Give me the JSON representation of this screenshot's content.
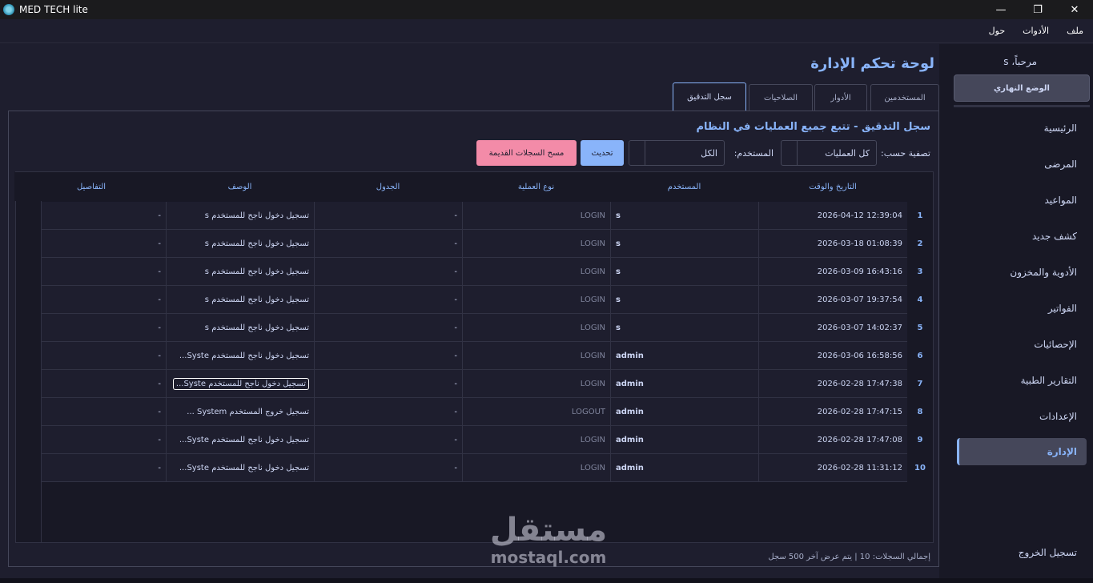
{
  "window": {
    "title": "MED TECH lite",
    "minimize": "—",
    "maximize": "❐",
    "close": "✕"
  },
  "menu": [
    "ملف",
    "الأدوات",
    "حول"
  ],
  "sidebar": {
    "welcome": "مرحباً، s",
    "theme_button": "الوضع النهاري",
    "items": [
      "الرئيسية",
      "المرضى",
      "المواعيد",
      "كشف جديد",
      "الأدوية والمخزون",
      "الفواتير",
      "الإحصائيات",
      "التقارير الطبية",
      "الإعدادات",
      "الإدارة"
    ],
    "active": "الإدارة",
    "logout": "تسجيل الخروج"
  },
  "main": {
    "title": "لوحة تحكم الإدارة",
    "tabs": [
      "المستخدمين",
      "الأدوار",
      "الصلاحيات",
      "سجل التدقيق"
    ],
    "active_tab": "سجل التدقيق"
  },
  "audit": {
    "title": "سجل التدقيق - تتبع جميع العمليات في النظام",
    "filter_label": "تصفية حسب:",
    "filter_value": "كل العمليات",
    "user_label": "المستخدم:",
    "user_value": "الكل",
    "refresh_button": "تحديث",
    "clear_button": "مسح السجلات القديمة",
    "columns": [
      "التاريخ والوقت",
      "المستخدم",
      "نوع العملية",
      "الجدول",
      "الوصف",
      "التفاصيل"
    ],
    "rows": [
      {
        "n": "1",
        "date": "2026-04-12 12:39:04",
        "user": "s",
        "op": "LOGIN",
        "table": "-",
        "desc": "تسجيل دخول ناجح للمستخدم s",
        "details": "-"
      },
      {
        "n": "2",
        "date": "2026-03-18 01:08:39",
        "user": "s",
        "op": "LOGIN",
        "table": "-",
        "desc": "تسجيل دخول ناجح للمستخدم s",
        "details": "-"
      },
      {
        "n": "3",
        "date": "2026-03-09 16:43:16",
        "user": "s",
        "op": "LOGIN",
        "table": "-",
        "desc": "تسجيل دخول ناجح للمستخدم s",
        "details": "-"
      },
      {
        "n": "4",
        "date": "2026-03-07 19:37:54",
        "user": "s",
        "op": "LOGIN",
        "table": "-",
        "desc": "تسجيل دخول ناجح للمستخدم s",
        "details": "-"
      },
      {
        "n": "5",
        "date": "2026-03-07 14:02:37",
        "user": "s",
        "op": "LOGIN",
        "table": "-",
        "desc": "تسجيل دخول ناجح للمستخدم s",
        "details": "-"
      },
      {
        "n": "6",
        "date": "2026-03-06 16:58:56",
        "user": "admin",
        "op": "LOGIN",
        "table": "-",
        "desc": "تسجيل دخول ناجح للمستخدم Syste...",
        "details": "-"
      },
      {
        "n": "7",
        "date": "2026-02-28 17:47:38",
        "user": "admin",
        "op": "LOGIN",
        "table": "-",
        "desc": "تسجيل دخول ناجح للمستخدم Syste...",
        "details": "-"
      },
      {
        "n": "8",
        "date": "2026-02-28 17:47:15",
        "user": "admin",
        "op": "LOGOUT",
        "table": "-",
        "desc": "تسجيل خروج المستخدم System ...",
        "details": "-"
      },
      {
        "n": "9",
        "date": "2026-02-28 17:47:08",
        "user": "admin",
        "op": "LOGIN",
        "table": "-",
        "desc": "تسجيل دخول ناجح للمستخدم Syste...",
        "details": "-"
      },
      {
        "n": "10",
        "date": "2026-02-28 11:31:12",
        "user": "admin",
        "op": "LOGIN",
        "table": "-",
        "desc": "تسجيل دخول ناجح للمستخدم Syste...",
        "details": "-"
      }
    ],
    "focused_row": 7,
    "footer": "إجمالي السجلات: 10 | يتم عرض آخر 500 سجل"
  },
  "watermark": {
    "arabic": "مستقل",
    "latin": "mostaql.com"
  },
  "colors": {
    "accent": "#89b4fa",
    "danger": "#f38ba8",
    "bg": "#1e1e2e",
    "sidebar": "#181825"
  }
}
